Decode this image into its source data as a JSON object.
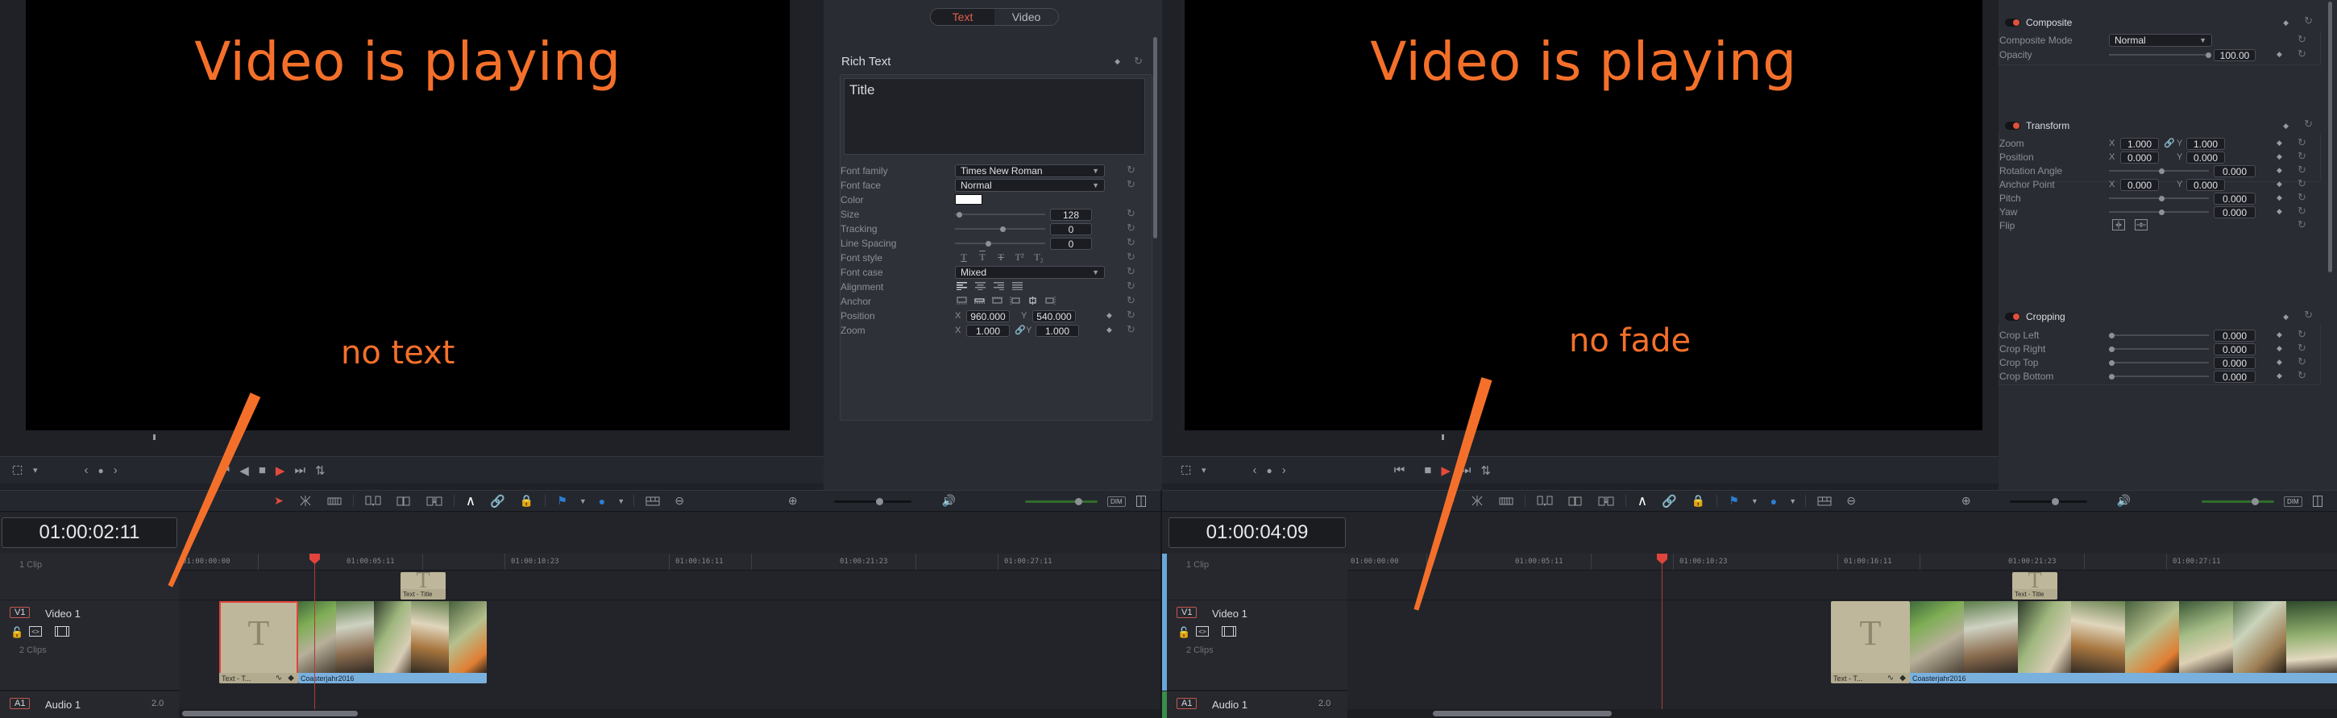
{
  "meta": {
    "app": "DaVinci Resolve — Edit page (side-by-side comparison)",
    "accent_red": "#e0443c",
    "accent_orange": "#F4702A",
    "panel_bg": "#2a2c33",
    "timeline_bg": "#22242a"
  },
  "viewers": {
    "left": {
      "overlay_text": "Video is playing"
    },
    "right": {
      "overlay_text": "Video is playing"
    }
  },
  "annotations": [
    {
      "text": "no text",
      "side": "left"
    },
    {
      "text": "no fade",
      "side": "right"
    }
  ],
  "transport": {
    "icons": [
      "crop-icon",
      "chevron-down-icon",
      "prev-marker-icon",
      "marker-dot-icon",
      "next-marker-icon",
      "jump-start-icon",
      "play-reverse-icon",
      "stop-icon",
      "play-icon",
      "jump-end-icon",
      "loop-icon"
    ]
  },
  "inspector_text": {
    "tabs": [
      {
        "label": "Text",
        "active": true
      },
      {
        "label": "Video",
        "active": false
      }
    ],
    "section_title": "Rich Text",
    "rich_text_value": "Title",
    "rows": [
      {
        "name": "font-family",
        "label": "Font family",
        "type": "combo",
        "value": "Times New Roman"
      },
      {
        "name": "font-face",
        "label": "Font face",
        "type": "combo",
        "value": "Normal"
      },
      {
        "name": "color",
        "label": "Color",
        "type": "swatch",
        "value": "#ffffff"
      },
      {
        "name": "size",
        "label": "Size",
        "type": "slider",
        "value": "128",
        "knob_pct": 2
      },
      {
        "name": "tracking",
        "label": "Tracking",
        "type": "slider",
        "value": "0",
        "knob_pct": 50
      },
      {
        "name": "line-spacing",
        "label": "Line Spacing",
        "type": "slider",
        "value": "0",
        "knob_pct": 34
      },
      {
        "name": "font-style",
        "label": "Font style",
        "type": "glyphs",
        "glyphs": [
          "underline-T-icon",
          "overline-T-icon",
          "strikethrough-T-icon",
          "superscript-T-icon",
          "subscript-T-icon"
        ]
      },
      {
        "name": "font-case",
        "label": "Font case",
        "type": "combo",
        "value": "Mixed"
      },
      {
        "name": "alignment",
        "label": "Alignment",
        "type": "glyphs",
        "glyphs": [
          "align-left-icon",
          "align-center-icon",
          "align-right-icon",
          "align-justify-icon"
        ]
      },
      {
        "name": "anchor",
        "label": "Anchor",
        "type": "glyphs",
        "glyphs": [
          "anchor-bottom-icon",
          "anchor-baseline-icon",
          "anchor-middle-icon",
          "anchor-left-icon",
          "anchor-center-icon",
          "anchor-right-icon"
        ]
      },
      {
        "name": "position",
        "label": "Position",
        "type": "xy",
        "x_label": "X",
        "x_value": "960.000",
        "y_label": "Y",
        "y_value": "540.000"
      },
      {
        "name": "zoom",
        "label": "Zoom",
        "type": "xy_link",
        "x_label": "X",
        "x_value": "1.000",
        "y_label": "Y",
        "y_value": "1.000"
      }
    ]
  },
  "inspector_video": {
    "sections": [
      {
        "name": "composite",
        "title": "Composite",
        "enabled": true,
        "rows": [
          {
            "name": "composite-mode",
            "label": "Composite Mode",
            "type": "combo",
            "value": "Normal"
          },
          {
            "name": "opacity",
            "label": "Opacity",
            "type": "slider_value",
            "value": "100.00",
            "knob_pct": 97
          }
        ]
      },
      {
        "name": "transform",
        "title": "Transform",
        "enabled": true,
        "rows": [
          {
            "name": "zoom",
            "label": "Zoom",
            "type": "xy_link",
            "x_label": "X",
            "x_value": "1.000",
            "y_label": "Y",
            "y_value": "1.000"
          },
          {
            "name": "position",
            "label": "Position",
            "type": "xy",
            "x_label": "X",
            "x_value": "0.000",
            "y_label": "Y",
            "y_value": "0.000"
          },
          {
            "name": "rotation-angle",
            "label": "Rotation Angle",
            "type": "slider_value",
            "value": "0.000",
            "knob_pct": 50
          },
          {
            "name": "anchor-point",
            "label": "Anchor Point",
            "type": "xy",
            "x_label": "X",
            "x_value": "0.000",
            "y_label": "Y",
            "y_value": "0.000"
          },
          {
            "name": "pitch",
            "label": "Pitch",
            "type": "slider_value",
            "value": "0.000",
            "knob_pct": 50
          },
          {
            "name": "yaw",
            "label": "Yaw",
            "type": "slider_value",
            "value": "0.000",
            "knob_pct": 50
          },
          {
            "name": "flip",
            "label": "Flip",
            "type": "flip",
            "glyphs": [
              "flip-horizontal-icon",
              "flip-vertical-icon"
            ]
          }
        ]
      },
      {
        "name": "cropping",
        "title": "Cropping",
        "enabled": true,
        "rows": [
          {
            "name": "crop-left",
            "label": "Crop Left",
            "type": "slider_value",
            "value": "0.000",
            "knob_pct": 0
          },
          {
            "name": "crop-right",
            "label": "Crop Right",
            "type": "slider_value",
            "value": "0.000",
            "knob_pct": 0
          },
          {
            "name": "crop-top",
            "label": "Crop Top",
            "type": "slider_value",
            "value": "0.000",
            "knob_pct": 0
          },
          {
            "name": "crop-bottom",
            "label": "Crop Bottom",
            "type": "slider_value",
            "value": "0.000",
            "knob_pct": 0
          }
        ]
      }
    ]
  },
  "timeline_toolbar": {
    "icons": [
      "selection-arrow-icon",
      "trim-edit-icon",
      "razor-icon",
      "insert-clip-icon",
      "overwrite-clip-icon",
      "replace-clip-icon",
      "snapping-magnet-icon",
      "link-clips-icon",
      "lock-track-icon",
      "flag-icon",
      "chevron-down-icon",
      "marker-icon",
      "chevron-down-icon",
      "timeline-view-options-icon",
      "zoom-out-icon",
      "zoom-slider",
      "zoom-in-icon",
      "speaker-icon",
      "audio-level-slider",
      "dim-button",
      "audio-meters-icon"
    ],
    "dim_label": "DIM"
  },
  "timelines": [
    {
      "name": "left-timeline",
      "timecode": "01:00:02:11",
      "header_clip_count": "1 Clip",
      "track_clip_count": "2 Clips",
      "video_track": {
        "badge": "V1",
        "name": "Video 1"
      },
      "audio_track": {
        "badge": "A1",
        "name": "Audio 1",
        "channels": "2.0"
      },
      "ruler_labels": [
        "01:00:00:00",
        "01:00:05:11",
        "01:00:10:23",
        "01:00:16:11",
        "01:00:21:23",
        "01:00:27:11"
      ],
      "upper_clip": {
        "label": "Text - Title"
      },
      "clips": [
        {
          "name": "title-clip",
          "label": "Text - T...",
          "type": "title",
          "selected": true
        },
        {
          "name": "video-clip",
          "label": "Coasterjahr2016",
          "type": "video",
          "selected": false
        }
      ]
    },
    {
      "name": "right-timeline",
      "timecode": "01:00:04:09",
      "header_clip_count": "1 Clip",
      "track_clip_count": "2 Clips",
      "video_track": {
        "badge": "V1",
        "name": "Video 1"
      },
      "audio_track": {
        "badge": "A1",
        "name": "Audio 1",
        "channels": "2.0"
      },
      "ruler_labels": [
        "01:00:00:00",
        "01:00:05:11",
        "01:00:10:23",
        "01:00:16:11",
        "01:00:21:23",
        "01:00:27:11"
      ],
      "upper_clip": {
        "label": "Text - Title"
      },
      "clips": [
        {
          "name": "title-clip",
          "label": "Text - T...",
          "type": "title",
          "selected": false
        },
        {
          "name": "video-clip",
          "label": "Coasterjahr2016",
          "type": "video",
          "selected": true
        }
      ]
    }
  ]
}
